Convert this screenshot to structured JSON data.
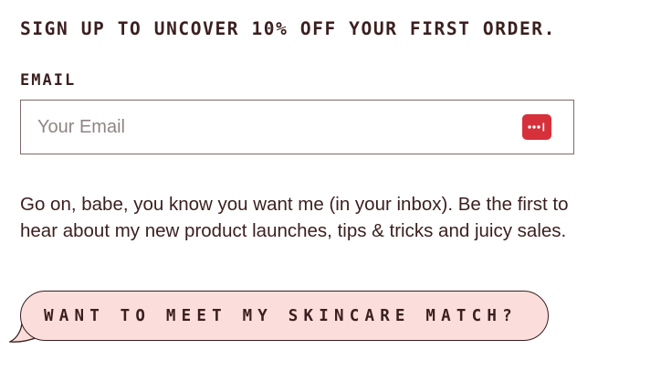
{
  "signup": {
    "headline": "SIGN UP TO UNCOVER 10% OFF YOUR FIRST ORDER.",
    "email_label": "EMAIL",
    "email_placeholder": "Your Email",
    "email_value": "",
    "password_manager_icon": "password-manager-icon",
    "description": "Go on, babe, you know you want me (in your inbox). Be the first to hear about my new product launches, tips & tricks and juicy sales."
  },
  "cta": {
    "label": "WANT TO MEET MY SKINCARE MATCH?"
  },
  "colors": {
    "text": "#3b1f1f",
    "cta_background": "#fbdedb",
    "icon_red": "#d6313b"
  }
}
